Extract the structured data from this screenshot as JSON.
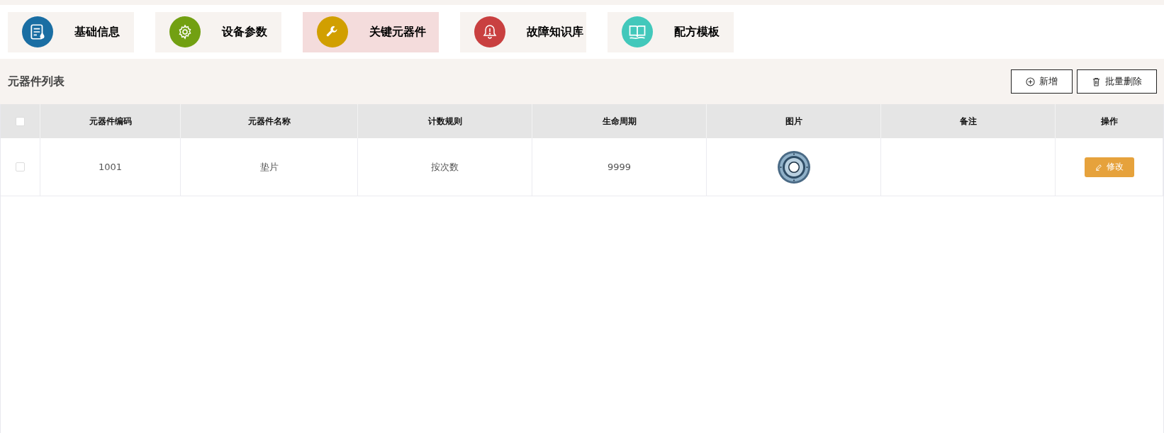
{
  "tabs": [
    {
      "label": "基础信息",
      "kind": "document",
      "color": "#1a6ea3",
      "selected": false
    },
    {
      "label": "设备参数",
      "kind": "gear",
      "color": "#72a012",
      "selected": false
    },
    {
      "label": "关键元器件",
      "kind": "wrench",
      "color": "#d19f00",
      "selected": true
    },
    {
      "label": "故障知识库",
      "kind": "bell",
      "color": "#c94040",
      "selected": false
    },
    {
      "label": "配方模板",
      "kind": "book",
      "color": "#42c8bb",
      "selected": false
    }
  ],
  "list": {
    "title": "元器件列表",
    "buttons": [
      {
        "label": "新增",
        "kind": "add"
      },
      {
        "label": "批量删除",
        "kind": "delete"
      }
    ]
  },
  "table": {
    "select_all": {
      "checked": false
    },
    "columns": [
      "元器件编码",
      "元器件名称",
      "计数规则",
      "生命周期",
      "图片",
      "备注",
      "操作"
    ],
    "rows": [
      {
        "checked": false,
        "code": "1001",
        "name": "垫片",
        "count_rule": "按次数",
        "lifecycle": "9999",
        "action": "修改"
      }
    ]
  }
}
